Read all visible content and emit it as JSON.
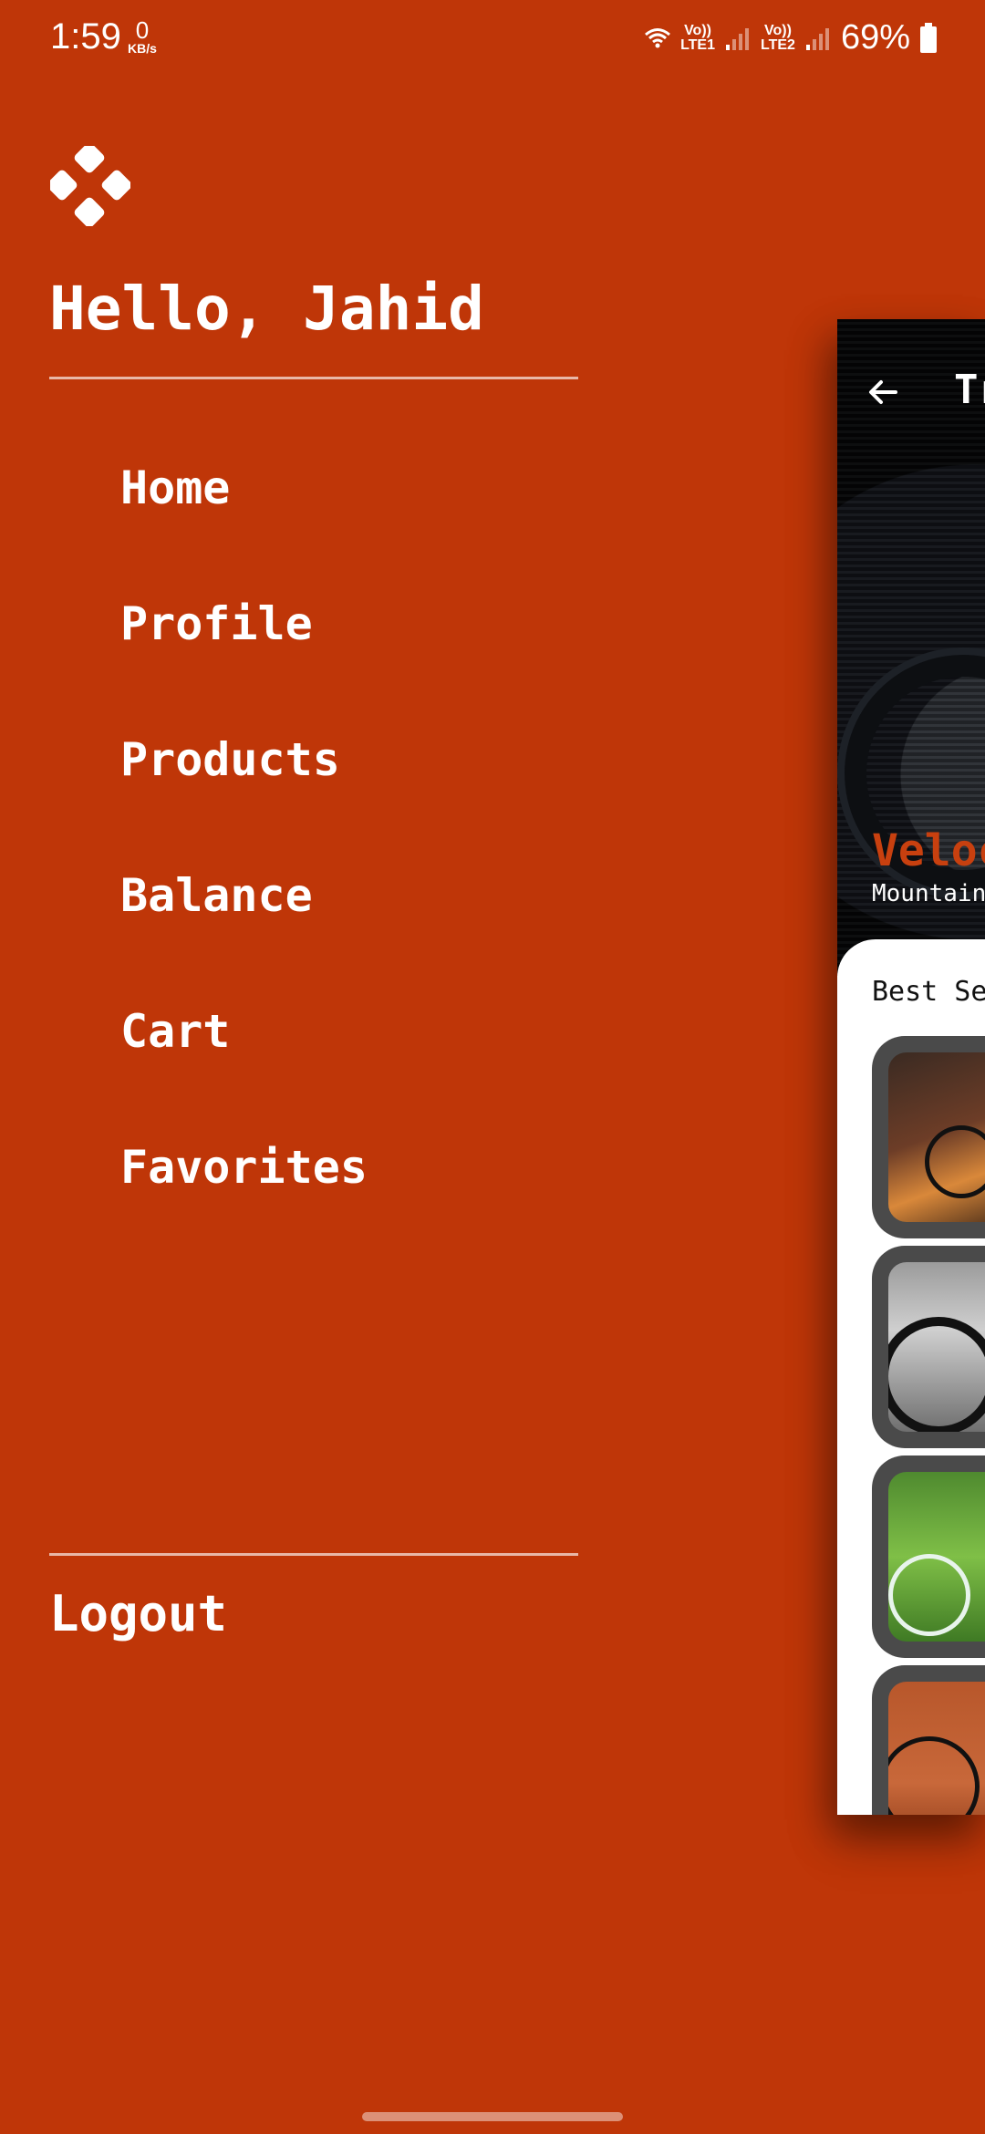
{
  "status_bar": {
    "time": "1:59",
    "net_speed_value": "0",
    "net_speed_unit": "KB/s",
    "sim1_label_top": "Vo))",
    "sim1_label_bottom": "LTE1",
    "sim2_label_top": "Vo))",
    "sim2_label_bottom": "LTE2",
    "battery": "69%"
  },
  "drawer": {
    "greeting": "Hello, Jahid",
    "menu": [
      {
        "label": "Home"
      },
      {
        "label": "Profile"
      },
      {
        "label": "Products"
      },
      {
        "label": "Balance"
      },
      {
        "label": "Cart"
      },
      {
        "label": "Favorites"
      }
    ],
    "logout_label": "Logout"
  },
  "main_screen": {
    "appbar_title": "Tr",
    "hero_title": "Veloc",
    "hero_subtitle": "Mountain",
    "section_title": "Best Se"
  },
  "colors": {
    "background": "#BF3608",
    "accent_text": "#C8400F",
    "card": "#4A4A4A"
  },
  "icons": {
    "logo": "diamond-grid-logo-icon",
    "back": "arrow-left-icon",
    "wifi": "wifi-icon",
    "signal": "signal-icon",
    "battery": "battery-icon"
  }
}
